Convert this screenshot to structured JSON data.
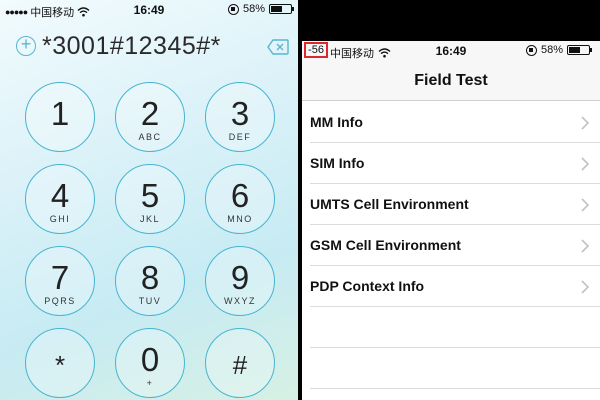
{
  "dialer": {
    "status": {
      "dots": "●●●●●",
      "carrier": "中国移动",
      "wifi_icon": "wifi-icon",
      "time": "16:49",
      "battery": "58%"
    },
    "entry": {
      "add_icon": "plus-circle-icon",
      "number": "*3001#12345#*",
      "delete_icon": "backspace-icon"
    },
    "keys": [
      {
        "digit": "1",
        "letters": ""
      },
      {
        "digit": "2",
        "letters": "ABC"
      },
      {
        "digit": "3",
        "letters": "DEF"
      },
      {
        "digit": "4",
        "letters": "GHI"
      },
      {
        "digit": "5",
        "letters": "JKL"
      },
      {
        "digit": "6",
        "letters": "MNO"
      },
      {
        "digit": "7",
        "letters": "PQRS"
      },
      {
        "digit": "8",
        "letters": "TUV"
      },
      {
        "digit": "9",
        "letters": "WXYZ"
      },
      {
        "digit": "*",
        "letters": ""
      },
      {
        "digit": "0",
        "letters": "+"
      },
      {
        "digit": "#",
        "letters": ""
      }
    ],
    "accent": "#47b4d0"
  },
  "field_test": {
    "status": {
      "signal": "-56",
      "carrier": "中国移动",
      "time": "16:49",
      "battery": "58%",
      "highlight_color": "#e0262b"
    },
    "title": "Field Test",
    "items": [
      {
        "label": "MM Info"
      },
      {
        "label": "SIM Info"
      },
      {
        "label": "UMTS Cell Environment"
      },
      {
        "label": "GSM Cell Environment"
      },
      {
        "label": "PDP Context Info"
      }
    ]
  }
}
